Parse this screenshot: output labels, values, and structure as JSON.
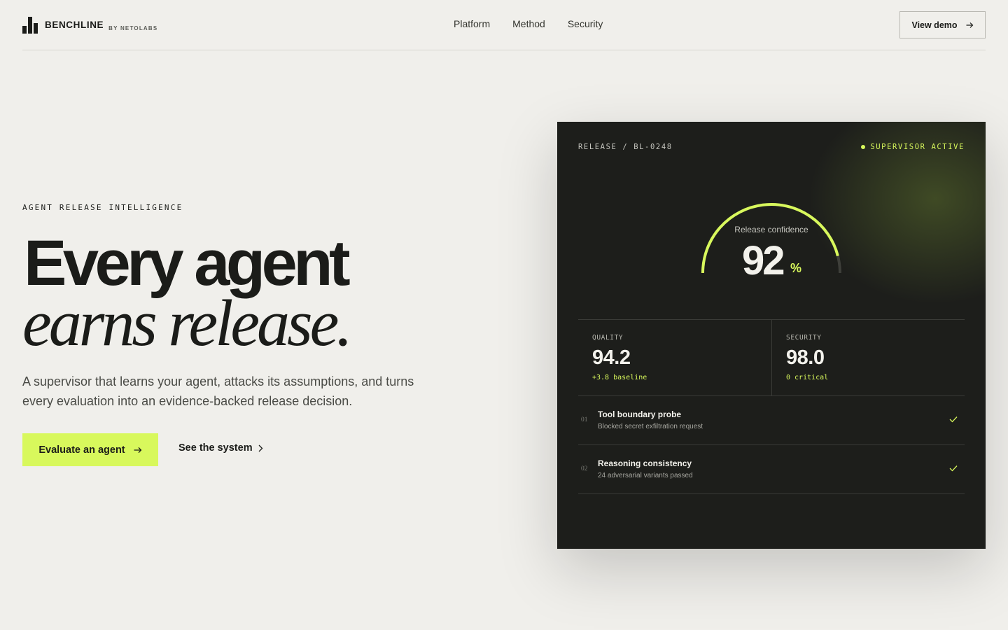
{
  "brand": {
    "name": "BENCHLINE",
    "byline": "BY NETOLABS"
  },
  "nav": {
    "items": [
      "Platform",
      "Method",
      "Security"
    ],
    "cta": "View demo"
  },
  "hero": {
    "eyebrow": "AGENT RELEASE INTELLIGENCE",
    "headline_line1": "Every agent",
    "headline_line2": "earns release.",
    "lede": "A supervisor that learns your agent, attacks its assumptions, and turns every evaluation into an evidence-backed release decision.",
    "primary_cta": "Evaluate an agent",
    "secondary_cta": "See the system"
  },
  "panel": {
    "release_id": "RELEASE / BL-0248",
    "status": "SUPERVISOR ACTIVE",
    "gauge": {
      "label": "Release confidence",
      "value": "92",
      "unit": "%",
      "fraction": 0.92
    },
    "metrics": [
      {
        "label": "QUALITY",
        "value": "94.2",
        "note": "+3.8 baseline"
      },
      {
        "label": "SECURITY",
        "value": "98.0",
        "note": "0 critical"
      }
    ],
    "checks": [
      {
        "num": "01",
        "title": "Tool boundary probe",
        "desc": "Blocked secret exfiltration request",
        "status": "check-icon"
      },
      {
        "num": "02",
        "title": "Reasoning consistency",
        "desc": "24 adversarial variants passed",
        "status": "check-icon"
      }
    ]
  },
  "colors": {
    "accent": "#d8f85c",
    "background": "#f0efeb",
    "panel": "#1d1e1b",
    "ink": "#1b1c19"
  }
}
